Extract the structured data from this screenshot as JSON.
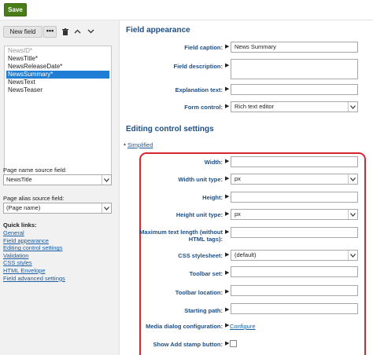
{
  "toolbar": {
    "save_label": "Save"
  },
  "left": {
    "new_field_label": "New field",
    "more_label": "•••",
    "fields": [
      {
        "label": "NewsID*",
        "muted": true,
        "selected": false
      },
      {
        "label": "NewsTitle*",
        "muted": false,
        "selected": false
      },
      {
        "label": "NewsReleaseDate*",
        "muted": false,
        "selected": false
      },
      {
        "label": "NewsSummary*",
        "muted": false,
        "selected": true
      },
      {
        "label": "NewsText",
        "muted": false,
        "selected": false
      },
      {
        "label": "NewsTeaser",
        "muted": false,
        "selected": false
      }
    ],
    "page_name_source_label": "Page name source field:",
    "page_name_source_value": "NewsTitle",
    "page_alias_source_label": "Page alias source field:",
    "page_alias_source_value": "(Page name)",
    "quick_links_title": "Quick links:",
    "quick_links": [
      "General",
      "Field appearance",
      "Editing control settings",
      "Validation",
      "CSS styles",
      "HTML Envelope",
      "Field advanced settings"
    ]
  },
  "field_appearance": {
    "title": "Field appearance",
    "caption_label": "Field caption:",
    "caption_value": "News Summary",
    "description_label": "Field description:",
    "description_value": "",
    "explanation_label": "Explanation text:",
    "explanation_value": "",
    "form_control_label": "Form control:",
    "form_control_value": "Rich text editor"
  },
  "editing_control": {
    "title": "Editing control settings",
    "simplified_label": "Simplified",
    "rows": {
      "width_label": "Width:",
      "width_unit_label": "Width unit type:",
      "width_unit_value": "px",
      "height_label": "Height:",
      "height_unit_label": "Height unit type:",
      "height_unit_value": "px",
      "max_text_label_1": "Maximum text length (without",
      "max_text_label_2": "HTML tags):",
      "css_label": "CSS stylesheet:",
      "css_value": "(default)",
      "toolbar_set_label": "Toolbar set:",
      "toolbar_location_label": "Toolbar location:",
      "starting_path_label": "Starting path:",
      "media_dialog_label": "Media dialog configuration:",
      "configure_label": "Configure",
      "add_stamp_label": "Show Add stamp button:"
    }
  },
  "icons": {
    "arrow": "▶",
    "dropdown": "∨",
    "delete": "🗑",
    "up": "∧",
    "down": "∨",
    "collapse": "▲"
  },
  "colors": {
    "save_green": "#497d17",
    "section_blue": "#1d4e86",
    "link_blue": "#1a5da0",
    "selection_blue": "#1f7ed4",
    "highlight_red": "#d8262e"
  }
}
